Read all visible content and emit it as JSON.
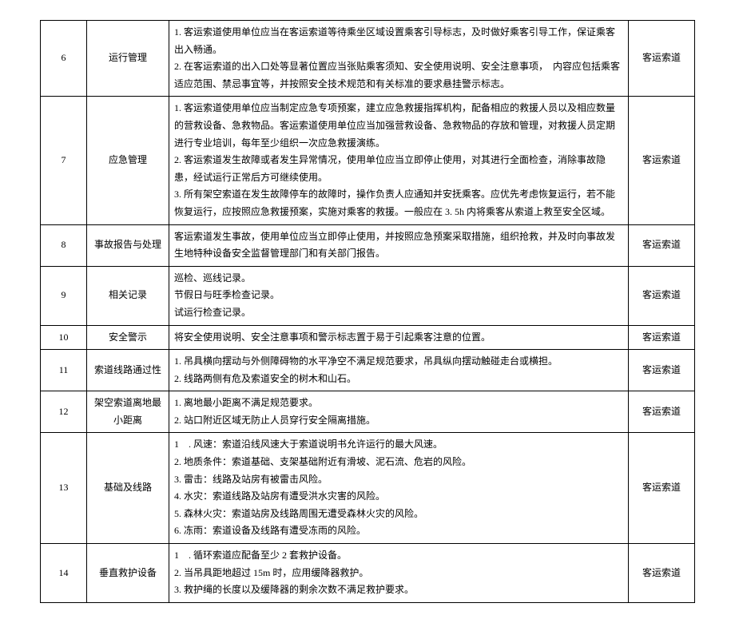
{
  "rows": [
    {
      "num": "6",
      "cat": "运行管理",
      "desc": [
        "1. 客运索道使用单位应当在客运索道等待乘坐区域设置乘客引导标志，及时做好乘客引导工作，保证乘客出入畅通。",
        "2. 在客运索道的出入口处等显著位置应当张贴乘客须知、安全使用说明、安全注意事项，　内容应包括乘客适应范围、禁忌事宜等，并按照安全技术规范和有关标准的要求悬挂警示标志。"
      ],
      "type": "客运索道"
    },
    {
      "num": "7",
      "cat": "应急管理",
      "desc": [
        "1. 客运索道使用单位应当制定应急专项预案，建立应急救援指挥机构，配备相应的救援人员以及相应数量的营救设备、急救物品。客运索道使用单位应当加强营救设备、急救物品的存放和管理，对救援人员定期进行专业培训，每年至少组织一次应急救援演练。",
        "2. 客运索道发生故障或者发生异常情况，使用单位应当立即停止使用，对其进行全面检查，消除事故隐患，经试运行正常后方可继续使用。",
        "3. 所有架空索道在发生故障停车的故障时，操作负责人应通知并安抚乘客。应优先考虑恢复运行，若不能恢复运行，应按照应急救援预案，实施对乘客的救援。一般应在 3. 5h 内将乘客从索道上救至安全区域。"
      ],
      "type": "客运索道"
    },
    {
      "num": "8",
      "cat": "事故报告与处理",
      "desc": [
        "客运索道发生事故，使用单位应当立即停止使用，并按照应急预案采取措施，组织抢救，并及时向事故发生地特种设备安全监督管理部门和有关部门报告。"
      ],
      "type": "客运索道"
    },
    {
      "num": "9",
      "cat": "相关记录",
      "desc": [
        "巡检、巡线记录。",
        "节假日与旺季检查记录。",
        "试运行检查记录。"
      ],
      "type": "客运索道"
    },
    {
      "num": "10",
      "cat": "安全警示",
      "desc": [
        "将安全使用说明、安全注意事项和警示标志置于易于引起乘客注意的位置。"
      ],
      "type": "客运索道"
    },
    {
      "num": "11",
      "cat": "索道线路通过性",
      "desc": [
        "1. 吊具横向摆动与外侧障碍物的水平净空不满足规范要求，吊具纵向摆动触碰走台或横担。",
        "2. 线路两侧有危及索道安全的树木和山石。"
      ],
      "type": "客运索道"
    },
    {
      "num": "12",
      "cat": "架空索道离地最小距离",
      "desc": [
        "1. 离地最小距离不满足规范要求。",
        "2. 站口附近区域无防止人员穿行安全隔离措施。"
      ],
      "type": "客运索道"
    },
    {
      "num": "13",
      "cat": "基础及线路",
      "desc": [
        "1　. 风速：索道沿线风速大于索道说明书允许运行的最大风速。",
        "2. 地质条件：索道基础、支架基础附近有滑坡、泥石流、危岩的风险。",
        "3. 雷击：线路及站房有被雷击风险。",
        "4. 水灾：索道线路及站房有遭受洪水灾害的风险。",
        "5. 森林火灾：索道站房及线路周围无遭受森林火灾的风险。",
        "6. 冻雨：索道设备及线路有遭受冻雨的风险。"
      ],
      "type": "客运索道"
    },
    {
      "num": "14",
      "cat": "垂直救护设备",
      "desc": [
        "1　. 循环索道应配备至少 2 套救护设备。",
        "2. 当吊具距地超过 15m 时，应用缓降器救护。",
        "3. 救护绳的长度以及缓降器的剩余次数不满足救护要求。"
      ],
      "type": "客运索道"
    }
  ]
}
